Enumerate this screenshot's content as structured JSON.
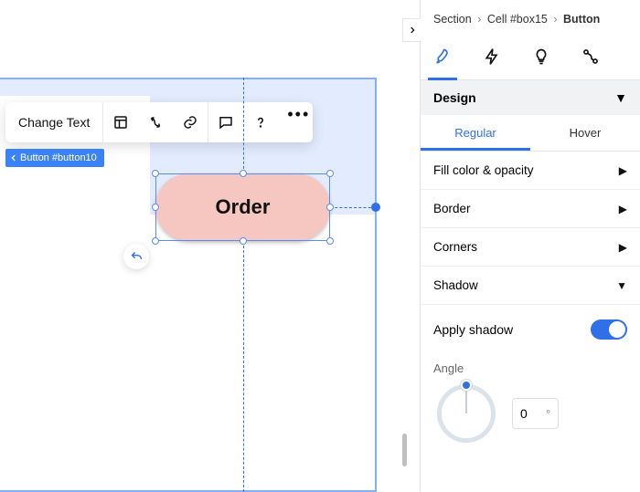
{
  "breadcrumb": {
    "a": "Section",
    "b": "Cell #box15",
    "c": "Button"
  },
  "mode_tabs": {
    "design": "design-tab",
    "actions": "actions-tab",
    "ideas": "ideas-tab",
    "link": "link-tab"
  },
  "toolbar": {
    "change_text": "Change Text"
  },
  "element_tag": "Button #button10",
  "button_label": "Order",
  "panel": {
    "design_header": "Design",
    "subtabs": {
      "regular": "Regular",
      "hover": "Hover"
    },
    "rows": {
      "fill": "Fill color & opacity",
      "border": "Border",
      "corners": "Corners",
      "shadow": "Shadow"
    },
    "apply_shadow": "Apply shadow",
    "angle_label": "Angle",
    "angle_value": "0",
    "angle_unit": "°"
  },
  "colors": {
    "accent": "#2f6fe8",
    "button_fill": "#f6c7c1"
  }
}
